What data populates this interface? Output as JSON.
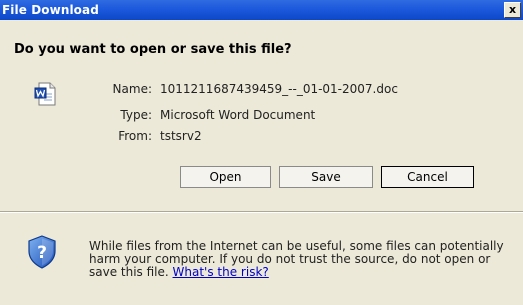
{
  "window": {
    "title": "File Download",
    "close_glyph": "x"
  },
  "prompt": {
    "question": "Do you want to open or save this file?"
  },
  "file": {
    "icon": "word-document-icon",
    "name_label": "Name:",
    "name_value": "1011211687439459_--_01-01-2007.doc",
    "type_label": "Type:",
    "type_value": "Microsoft Word Document",
    "from_label": "From:",
    "from_value": "tstsrv2"
  },
  "buttons": {
    "open_label": "Open",
    "save_label": "Save",
    "cancel_label": "Cancel"
  },
  "warning": {
    "icon": "shield-question-icon",
    "text": "While files from the Internet can be useful, some files can potentially harm your computer. If you do not trust the source, do not open or save this file. ",
    "link_label": "What's the risk?"
  },
  "colors": {
    "titlebar": "#0c48c8",
    "dialog_bg": "#ece9d8",
    "link": "#0000cc"
  }
}
